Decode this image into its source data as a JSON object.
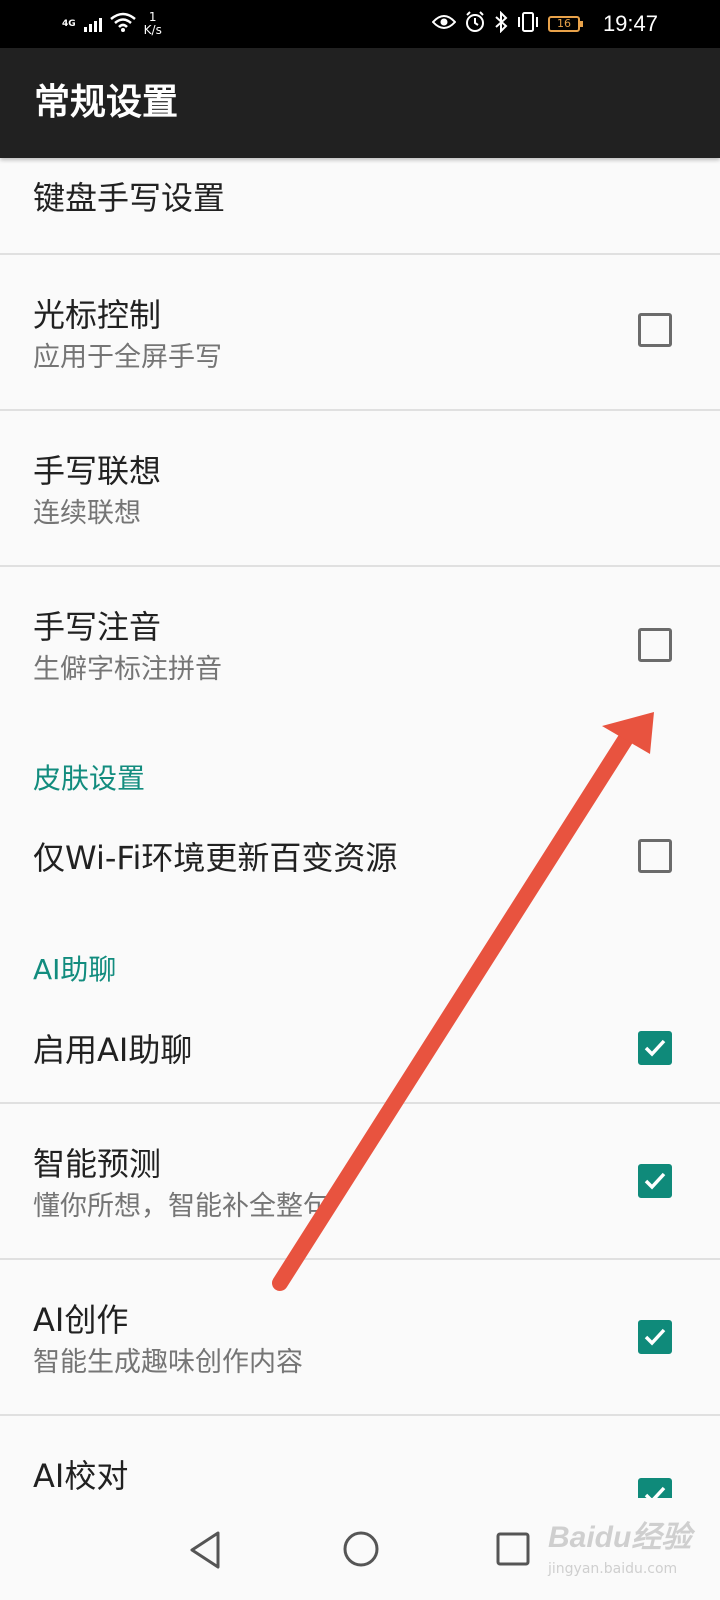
{
  "status_bar": {
    "network": "4G",
    "speed_value": "1",
    "speed_unit": "K/s",
    "battery": "16",
    "time": "19:47",
    "icons": [
      "signal-icon",
      "wifi-icon",
      "eye-icon",
      "alarm-icon",
      "bluetooth-icon",
      "vibrate-icon",
      "battery-icon"
    ]
  },
  "app_bar": {
    "title": "常规设置"
  },
  "settings": {
    "keyboard_handwriting": {
      "title": "键盘手写设置"
    },
    "cursor_control": {
      "title": "光标控制",
      "summary": "应用于全屏手写",
      "checked": false
    },
    "handwriting_association": {
      "title": "手写联想",
      "summary": "连续联想"
    },
    "handwriting_phonetic": {
      "title": "手写注音",
      "summary": "生僻字标注拼音",
      "checked": false
    },
    "skin_section": {
      "header": "皮肤设置"
    },
    "wifi_only_update": {
      "title": "仅Wi-Fi环境更新百变资源",
      "checked": false
    },
    "ai_section": {
      "header": "AI助聊"
    },
    "enable_ai_chat": {
      "title": "启用AI助聊",
      "checked": true
    },
    "smart_prediction": {
      "title": "智能预测",
      "summary": "懂你所想，智能补全整句",
      "checked": true
    },
    "ai_creation": {
      "title": "AI创作",
      "summary": "智能生成趣味创作内容",
      "checked": true
    },
    "ai_proofread": {
      "title": "AI校对",
      "checked": true
    }
  },
  "nav_bar": {
    "icons": [
      "back-icon",
      "home-icon",
      "recents-icon"
    ]
  },
  "annotation": {
    "color": "#e8533f"
  },
  "watermark": {
    "text": "Baidu经验",
    "sub": "jingyan.baidu.com"
  },
  "colors": {
    "accent": "#0f8a7a",
    "section_header": "#128c7e",
    "app_bar": "#212121"
  }
}
